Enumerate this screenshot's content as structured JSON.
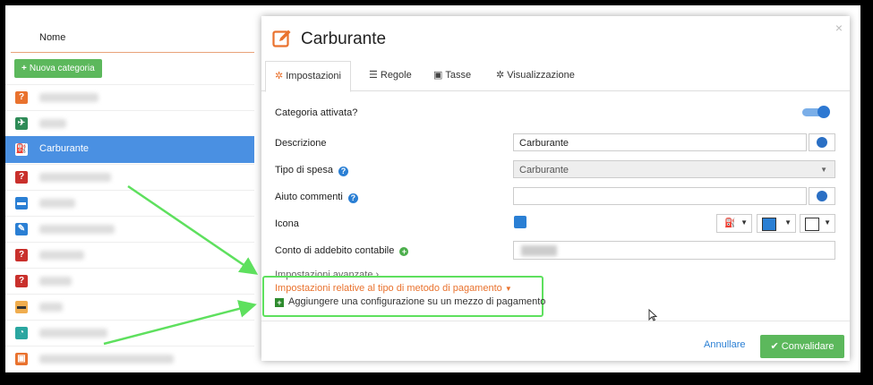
{
  "list": {
    "header": "Nome",
    "add_button": "Nuova categoria",
    "selected_item": "Carburante",
    "icon_colors": [
      "#e9722e",
      "#2e8b57",
      "#4a90e2",
      "#c9302c",
      "#2a7fd4",
      "#2a7fd4",
      "#c9302c",
      "#c9302c",
      "#f0ad4e",
      "#2aa6a0",
      "#e9722e"
    ]
  },
  "modal": {
    "title": "Carburante",
    "title_icon": "edit-icon",
    "close": "×",
    "tabs": [
      {
        "label": "Impostazioni",
        "icon": "gear-icon"
      },
      {
        "label": "Regole",
        "icon": "sliders-icon"
      },
      {
        "label": "Tasse",
        "icon": "money-icon"
      },
      {
        "label": "Visualizzazione",
        "icon": "gears-icon"
      }
    ],
    "fields": {
      "categoria_attivata": "Categoria attivata?",
      "descrizione_label": "Descrizione",
      "descrizione_value": "Carburante",
      "tipo_spesa_label": "Tipo di spesa",
      "tipo_spesa_value": "Carburante",
      "aiuto_commenti_label": "Aiuto commenti",
      "aiuto_commenti_value": "",
      "icona_label": "Icona",
      "conto_label": "Conto di addebito contabile"
    },
    "help_symbol": "?",
    "plus_symbol": "+",
    "impostazioni_avanzate": "Impostazioni avanzate",
    "pagamento_settings": "Impostazioni relative al tipo di metodo di pagamento",
    "aggiungere_config": "Aggiungere una configurazione su un mezzo di pagamento",
    "cancel_label": "Annullare",
    "confirm_label": "Convalidare"
  },
  "colors": {
    "accent_orange": "#e9722e",
    "primary_blue": "#2a7fd4",
    "success_green": "#5cb85c",
    "annotation_green": "#5ee05e"
  }
}
